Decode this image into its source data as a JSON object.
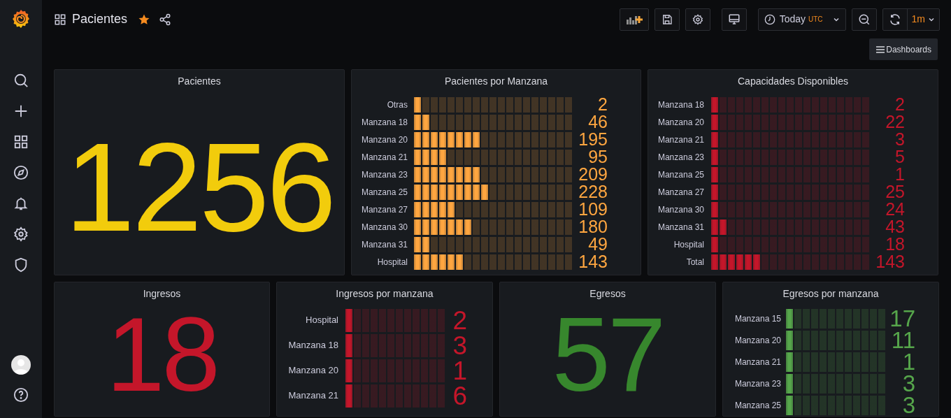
{
  "header": {
    "title": "Pacientes",
    "starred": true
  },
  "toolbar": {
    "time_range": "Today",
    "timezone": "UTC",
    "refresh_interval": "1m",
    "dashboards_button": "Dashboards"
  },
  "panels": [
    {
      "kind": "stat",
      "title": "Pacientes",
      "value": "1256",
      "color": "#f2cc0c"
    },
    {
      "kind": "bargauge",
      "title": "Pacientes por Manzana",
      "color": "#ffa640",
      "rows": [
        {
          "label": "Otras",
          "value": "2",
          "level": 0.05
        },
        {
          "label": "Manzana 18",
          "value": "46",
          "level": 0.11
        },
        {
          "label": "Manzana 20",
          "value": "195",
          "level": 0.42
        },
        {
          "label": "Manzana 21",
          "value": "95",
          "level": 0.21
        },
        {
          "label": "Manzana 23",
          "value": "209",
          "level": 0.42
        },
        {
          "label": "Manzana 25",
          "value": "228",
          "level": 0.47
        },
        {
          "label": "Manzana 27",
          "value": "109",
          "level": 0.26
        },
        {
          "label": "Manzana 30",
          "value": "180",
          "level": 0.37
        },
        {
          "label": "Manzana 31",
          "value": "49",
          "level": 0.11
        },
        {
          "label": "Hospital",
          "value": "143",
          "level": 0.32
        }
      ]
    },
    {
      "kind": "bargauge",
      "title": "Capacidades Disponibles",
      "color": "#c4162a",
      "rows": [
        {
          "label": "Manzana 18",
          "value": "2",
          "level": 0.05
        },
        {
          "label": "Manzana 20",
          "value": "22",
          "level": 0.05
        },
        {
          "label": "Manzana 21",
          "value": "3",
          "level": 0.05
        },
        {
          "label": "Manzana 23",
          "value": "5",
          "level": 0.05
        },
        {
          "label": "Manzana 25",
          "value": "1",
          "level": 0.05
        },
        {
          "label": "Manzana 27",
          "value": "25",
          "level": 0.05
        },
        {
          "label": "Manzana 30",
          "value": "24",
          "level": 0.05
        },
        {
          "label": "Manzana 31",
          "value": "43",
          "level": 0.11
        },
        {
          "label": "Hospital",
          "value": "18",
          "level": 0.05
        },
        {
          "label": "Total",
          "value": "143",
          "level": 0.32
        }
      ]
    },
    {
      "kind": "stat",
      "title": "Ingresos",
      "value": "18",
      "color": "#c4162a"
    },
    {
      "kind": "bargauge",
      "title": "Ingresos por manzana",
      "color": "#c4162a",
      "rows": [
        {
          "label": "Hospital",
          "value": "2",
          "level": 0.08
        },
        {
          "label": "Manzana 18",
          "value": "3",
          "level": 0.08
        },
        {
          "label": "Manzana 20",
          "value": "1",
          "level": 0.08
        },
        {
          "label": "Manzana 21",
          "value": "6",
          "level": 0.08
        }
      ]
    },
    {
      "kind": "stat",
      "title": "Egresos",
      "value": "57",
      "color": "#37872d"
    },
    {
      "kind": "bargauge",
      "title": "Egresos por manzana",
      "color": "#56a64b",
      "rows": [
        {
          "label": "Manzana 15",
          "value": "17",
          "level": 0.08
        },
        {
          "label": "Manzana 20",
          "value": "11",
          "level": 0.08
        },
        {
          "label": "Manzana 21",
          "value": "1",
          "level": 0.08
        },
        {
          "label": "Manzana 23",
          "value": "3",
          "level": 0.08
        },
        {
          "label": "Manzana 25",
          "value": "3",
          "level": 0.08
        }
      ]
    }
  ]
}
